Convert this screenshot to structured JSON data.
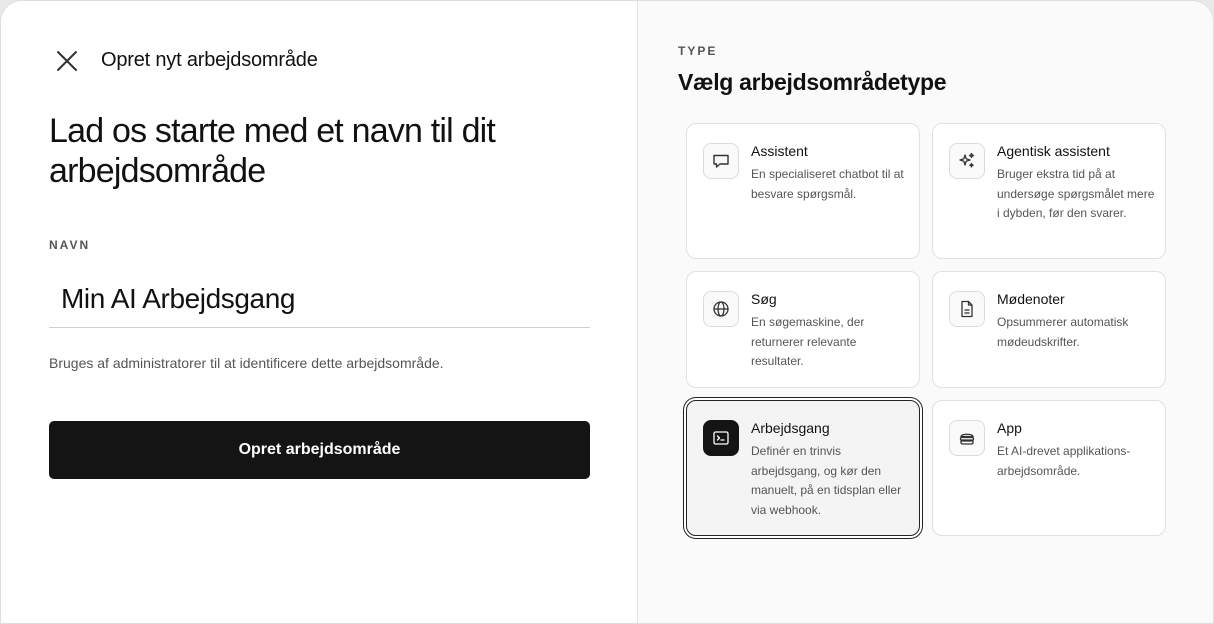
{
  "dialog": {
    "title": "Opret nyt arbejdsområde",
    "headline": "Lad os starte med et navn til dit arbejdsområde",
    "name_label": "NAVN",
    "name_value": "Min AI Arbejdsgang",
    "helper_text": "Bruges af administratorer til at identificere dette arbejdsområde.",
    "create_button": "Opret arbejdsområde"
  },
  "type_panel": {
    "label": "TYPE",
    "title": "Vælg arbejdsområdetype",
    "selected": "Arbejdsgang",
    "options": [
      {
        "title": "Assistent",
        "description": "En specialiseret chatbot til at besvare spørgsmål.",
        "icon": "chat-bubble-icon"
      },
      {
        "title": "Agentisk assistent",
        "description": "Bruger ekstra tid på at undersøge spørgsmålet mere i dybden, før den svarer.",
        "icon": "sparkles-icon"
      },
      {
        "title": "Søg",
        "description": "En søgemaskine, der returnerer relevante resultater.",
        "icon": "globe-icon"
      },
      {
        "title": "Mødenoter",
        "description": "Opsummerer automatisk mødeudskrifter.",
        "icon": "document-icon"
      },
      {
        "title": "Arbejdsgang",
        "description": "Definér en trinvis arbejdsgang, og kør den manuelt, på en tidsplan eller via webhook.",
        "icon": "terminal-icon"
      },
      {
        "title": "App",
        "description": "Et AI-drevet applikations-arbejdsområde.",
        "icon": "stack-icon"
      }
    ]
  },
  "colors": {
    "primary_button": "#141414",
    "selected_border": "#222222",
    "panel_background": "#fafafa"
  }
}
